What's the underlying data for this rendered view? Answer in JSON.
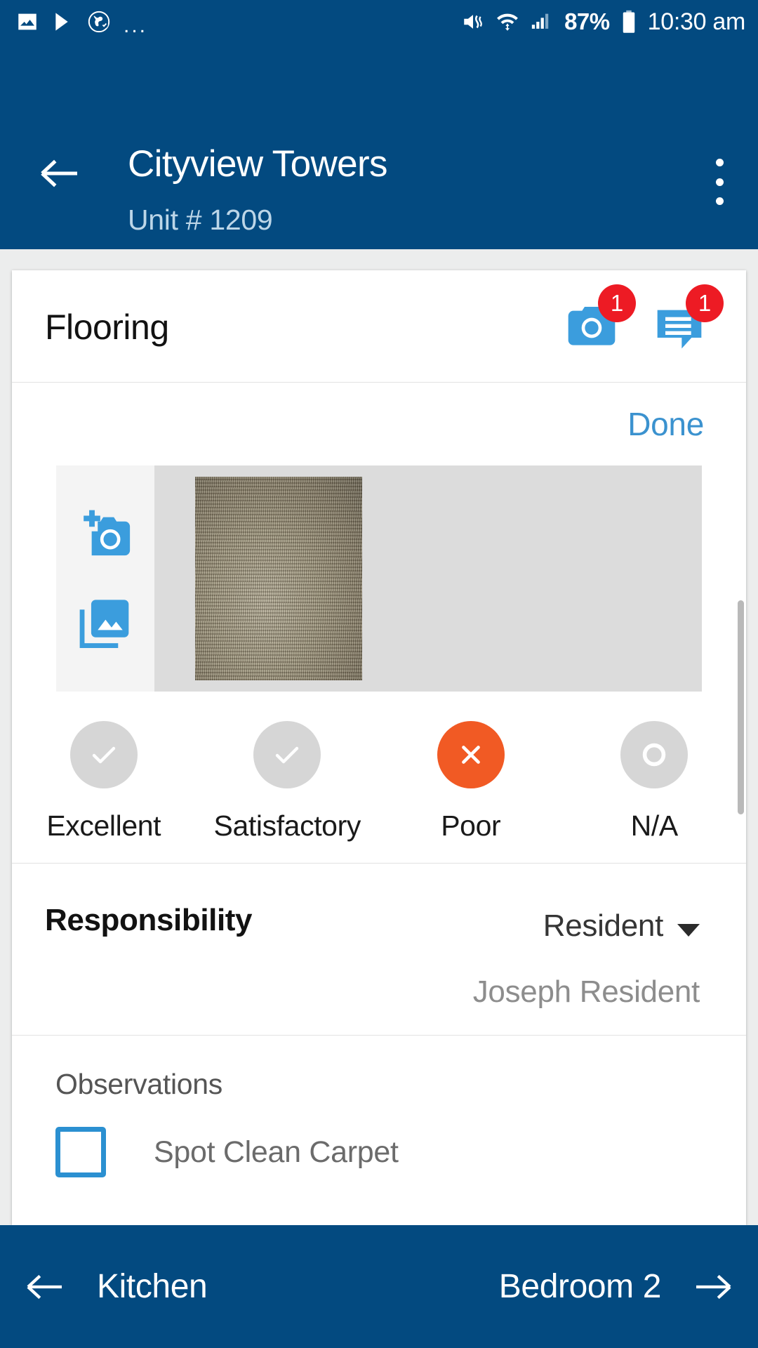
{
  "status_bar": {
    "icons_left": [
      "image-icon",
      "play-store-icon",
      "globe-icon"
    ],
    "overflow": "...",
    "vibrate_icon": "vibrate-icon",
    "wifi_icon": "wifi-icon",
    "signal_icon": "signal-icon",
    "battery_percent": "87%",
    "battery_icon": "battery-icon",
    "time": "10:30 am"
  },
  "app_bar": {
    "back_icon": "back-arrow-icon",
    "title": "Cityview Towers",
    "subtitle": "Unit # 1209",
    "overflow_icon": "overflow-menu-icon"
  },
  "card": {
    "title": "Flooring",
    "camera": {
      "icon": "camera-icon",
      "badge": "1"
    },
    "comments": {
      "icon": "comment-icon",
      "badge": "1"
    },
    "done_label": "Done",
    "photo_panel": {
      "add_photo_icon": "add-photo-icon",
      "gallery_icon": "photo-library-icon",
      "thumbnail_alt": "carpet-photo-thumbnail"
    },
    "ratings": [
      {
        "label": "Excellent",
        "glyph": "check",
        "selected": false
      },
      {
        "label": "Satisfactory",
        "glyph": "check",
        "selected": false
      },
      {
        "label": "Poor",
        "glyph": "cross",
        "selected": true
      },
      {
        "label": "N/A",
        "glyph": "ring",
        "selected": false
      }
    ],
    "responsibility": {
      "label": "Responsibility",
      "value": "Resident",
      "caret_icon": "chevron-down-icon",
      "person": "Joseph Resident"
    },
    "observations": {
      "title": "Observations",
      "items": [
        {
          "label": "Spot Clean Carpet",
          "checked": false
        }
      ]
    }
  },
  "bottom_nav": {
    "prev_icon": "arrow-left-icon",
    "prev_label": "Kitchen",
    "next_label": "Bedroom 2",
    "next_icon": "arrow-right-icon"
  },
  "colors": {
    "brand_blue": "#034a80",
    "accent_blue": "#3b92cf",
    "badge_red": "#ed1b24",
    "selected_orange": "#f15a24",
    "page_bg": "#eceded"
  }
}
